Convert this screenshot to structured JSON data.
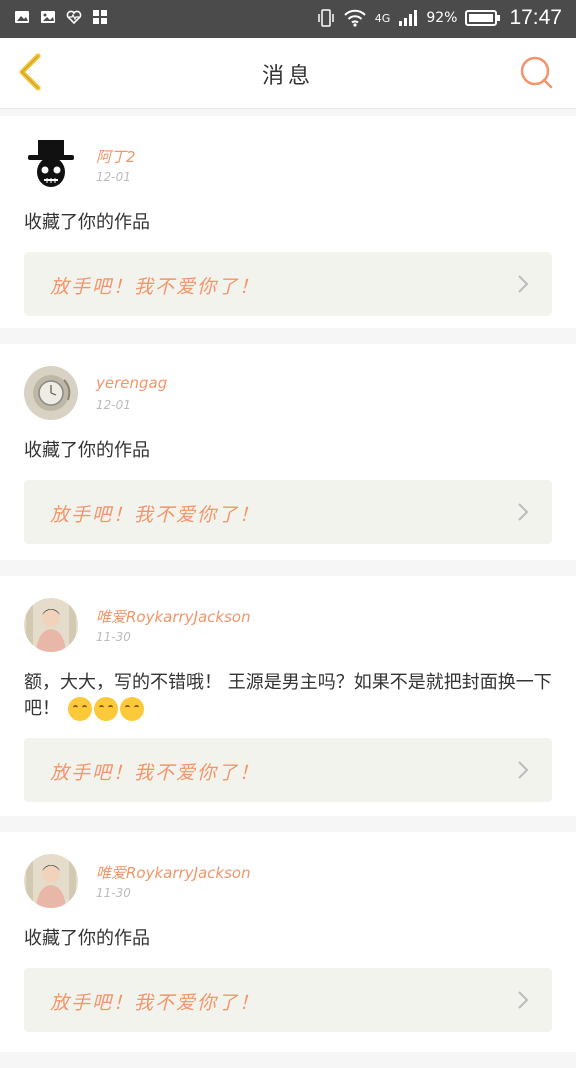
{
  "status_bar": {
    "network": "4G",
    "battery": "92%",
    "time": "17:47"
  },
  "header": {
    "title": "消息"
  },
  "colors": {
    "accent": "#f2956a",
    "back_icon": "#f2c230"
  },
  "messages": [
    {
      "user": "阿丁2",
      "date": "12-01",
      "text": "收藏了你的作品",
      "emojis": "",
      "work_title": "放手吧！我不爱你了！"
    },
    {
      "user": "yerengag",
      "date": "12-01",
      "text": "收藏了你的作品",
      "emojis": "",
      "work_title": "放手吧！我不爱你了！"
    },
    {
      "user": "唯爱RoykarryJackson",
      "date": "11-30",
      "text": "额，大大，写的不错哦！ 王源是男主吗？如果不是就把封面换一下吧！",
      "emojis": "😊😊😊",
      "work_title": "放手吧！我不爱你了！"
    },
    {
      "user": "唯爱RoykarryJackson",
      "date": "11-30",
      "text": "收藏了你的作品",
      "emojis": "",
      "work_title": "放手吧！我不爱你了！"
    }
  ]
}
